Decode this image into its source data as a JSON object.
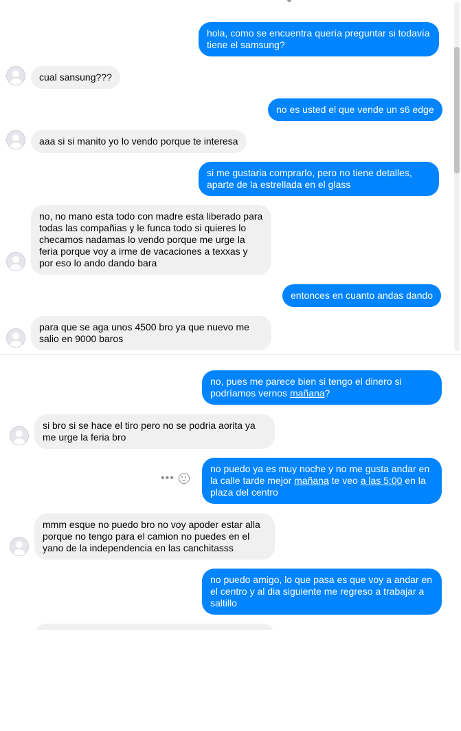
{
  "messages_top": [
    {
      "text": "hola, como se encuentra quería preguntar si todavía tiene el samsung?"
    },
    {
      "text": "cual sansung???"
    },
    {
      "text": "no es usted el que vende un s6 edge"
    },
    {
      "text": "aaa si si manito yo lo vendo porque te interesa"
    },
    {
      "text": "si me gustaria comprarlo, pero no tiene detalles, aparte de la estrellada en el glass"
    },
    {
      "text": "no, no mano esta todo con madre esta liberado para todas las compañias  y le funca todo si quieres lo checamos nadamas lo vendo porque me urge la feria porque  voy a irme de vacaciones a texxas y por eso lo ando dando bara"
    },
    {
      "text": "entonces en cuanto andas dando"
    },
    {
      "text": "para que se aga unos 4500 bro ya que nuevo me salio en 9000 baros"
    }
  ],
  "messages_bottom": [
    {
      "before": "no, pues me parece bien si tengo el dinero si podríamos vernos ",
      "link": "mañana",
      "after": "?"
    },
    {
      "text": "si bro si se hace el tiro pero no se podria aorita ya me urge la feria bro"
    },
    {
      "a": "no puedo ya es muy noche y no me gusta andar en la calle tarde mejor ",
      "link1": "mañana",
      "b": " te veo ",
      "link2": "a las 5:00",
      "c": " en la plaza del centro"
    },
    {
      "text": "mmm esque no puedo bro no voy apoder estar alla porque no tengo para el camion no  puedes en el yano de la independencia en las canchitasss"
    },
    {
      "text": "no puedo amigo, lo que pasa es que voy a andar en el centro y al dia siguiente me regreso a trabajar a saltillo"
    }
  ],
  "icons": {
    "more": "more-options-icon",
    "emoji": "emoji-reaction-icon",
    "avatar": "user-avatar-icon"
  },
  "colors": {
    "outgoing": "#0084ff",
    "incoming": "#f0f0f0"
  }
}
